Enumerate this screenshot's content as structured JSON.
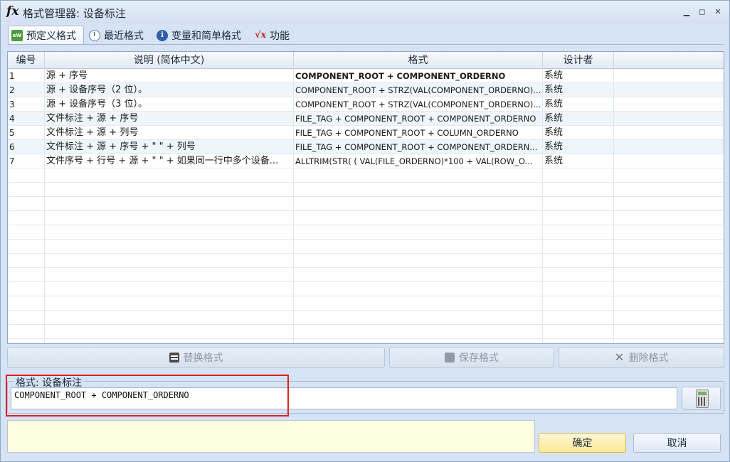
{
  "window": {
    "title": "格式管理器: 设备标注",
    "title_icon": "fx"
  },
  "tabs": [
    {
      "label": "预定义格式",
      "icon": "predefined-format-icon",
      "active": true
    },
    {
      "label": "最近格式",
      "icon": "clock-icon",
      "active": false
    },
    {
      "label": "变量和简单格式",
      "icon": "info-icon",
      "active": false
    },
    {
      "label": "功能",
      "icon": "sqrt-function-icon",
      "active": false
    }
  ],
  "grid": {
    "columns": [
      "编号",
      "说明 (简体中文)",
      "格式",
      "设计者"
    ],
    "rows": [
      {
        "num": "1",
        "desc": "源 + 序号",
        "format": "COMPONENT_ROOT + COMPONENT_ORDERNO",
        "designer": "系统",
        "bold": true
      },
      {
        "num": "2",
        "desc": "源 + 设备序号（2 位）。",
        "format": "COMPONENT_ROOT + STRZ(VAL(COMPONENT_ORDERNO)...",
        "designer": "系统",
        "bold": false
      },
      {
        "num": "3",
        "desc": "源 + 设备序号（3 位）。",
        "format": "COMPONENT_ROOT + STRZ(VAL(COMPONENT_ORDERNO)...",
        "designer": "系统",
        "bold": false
      },
      {
        "num": "4",
        "desc": "文件标注 + 源 + 序号",
        "format": "FILE_TAG + COMPONENT_ROOT + COMPONENT_ORDERNO",
        "designer": "系统",
        "bold": false
      },
      {
        "num": "5",
        "desc": "文件标注 + 源 + 列号",
        "format": "FILE_TAG + COMPONENT_ROOT + COLUMN_ORDERNO",
        "designer": "系统",
        "bold": false
      },
      {
        "num": "6",
        "desc": "文件标注 + 源 + 序号 + \" \" + 列号",
        "format": "FILE_TAG + COMPONENT_ROOT + COMPONENT_ORDERN...",
        "designer": "系统",
        "bold": false
      },
      {
        "num": "7",
        "desc": "文件序号 + 行号 + 源 + \" \" + 如果同一行中多个设备...",
        "format": "ALLTRIM(STR( ( VAL(FILE_ORDERNO)*100 + VAL(ROW_O...",
        "designer": "系统",
        "bold": false
      }
    ]
  },
  "actions": {
    "replace_label": "替换格式",
    "save_label": "保存格式",
    "delete_label": "删除格式"
  },
  "format_group": {
    "legend": "格式: 设备标注",
    "value": "COMPONENT_ROOT + COMPONENT_ORDERNO"
  },
  "dialog": {
    "ok_label": "确定",
    "cancel_label": "取消"
  },
  "colors": {
    "highlight": "#e02020",
    "window_bg": "#d6e3f4",
    "message_bg": "#fefee1"
  }
}
